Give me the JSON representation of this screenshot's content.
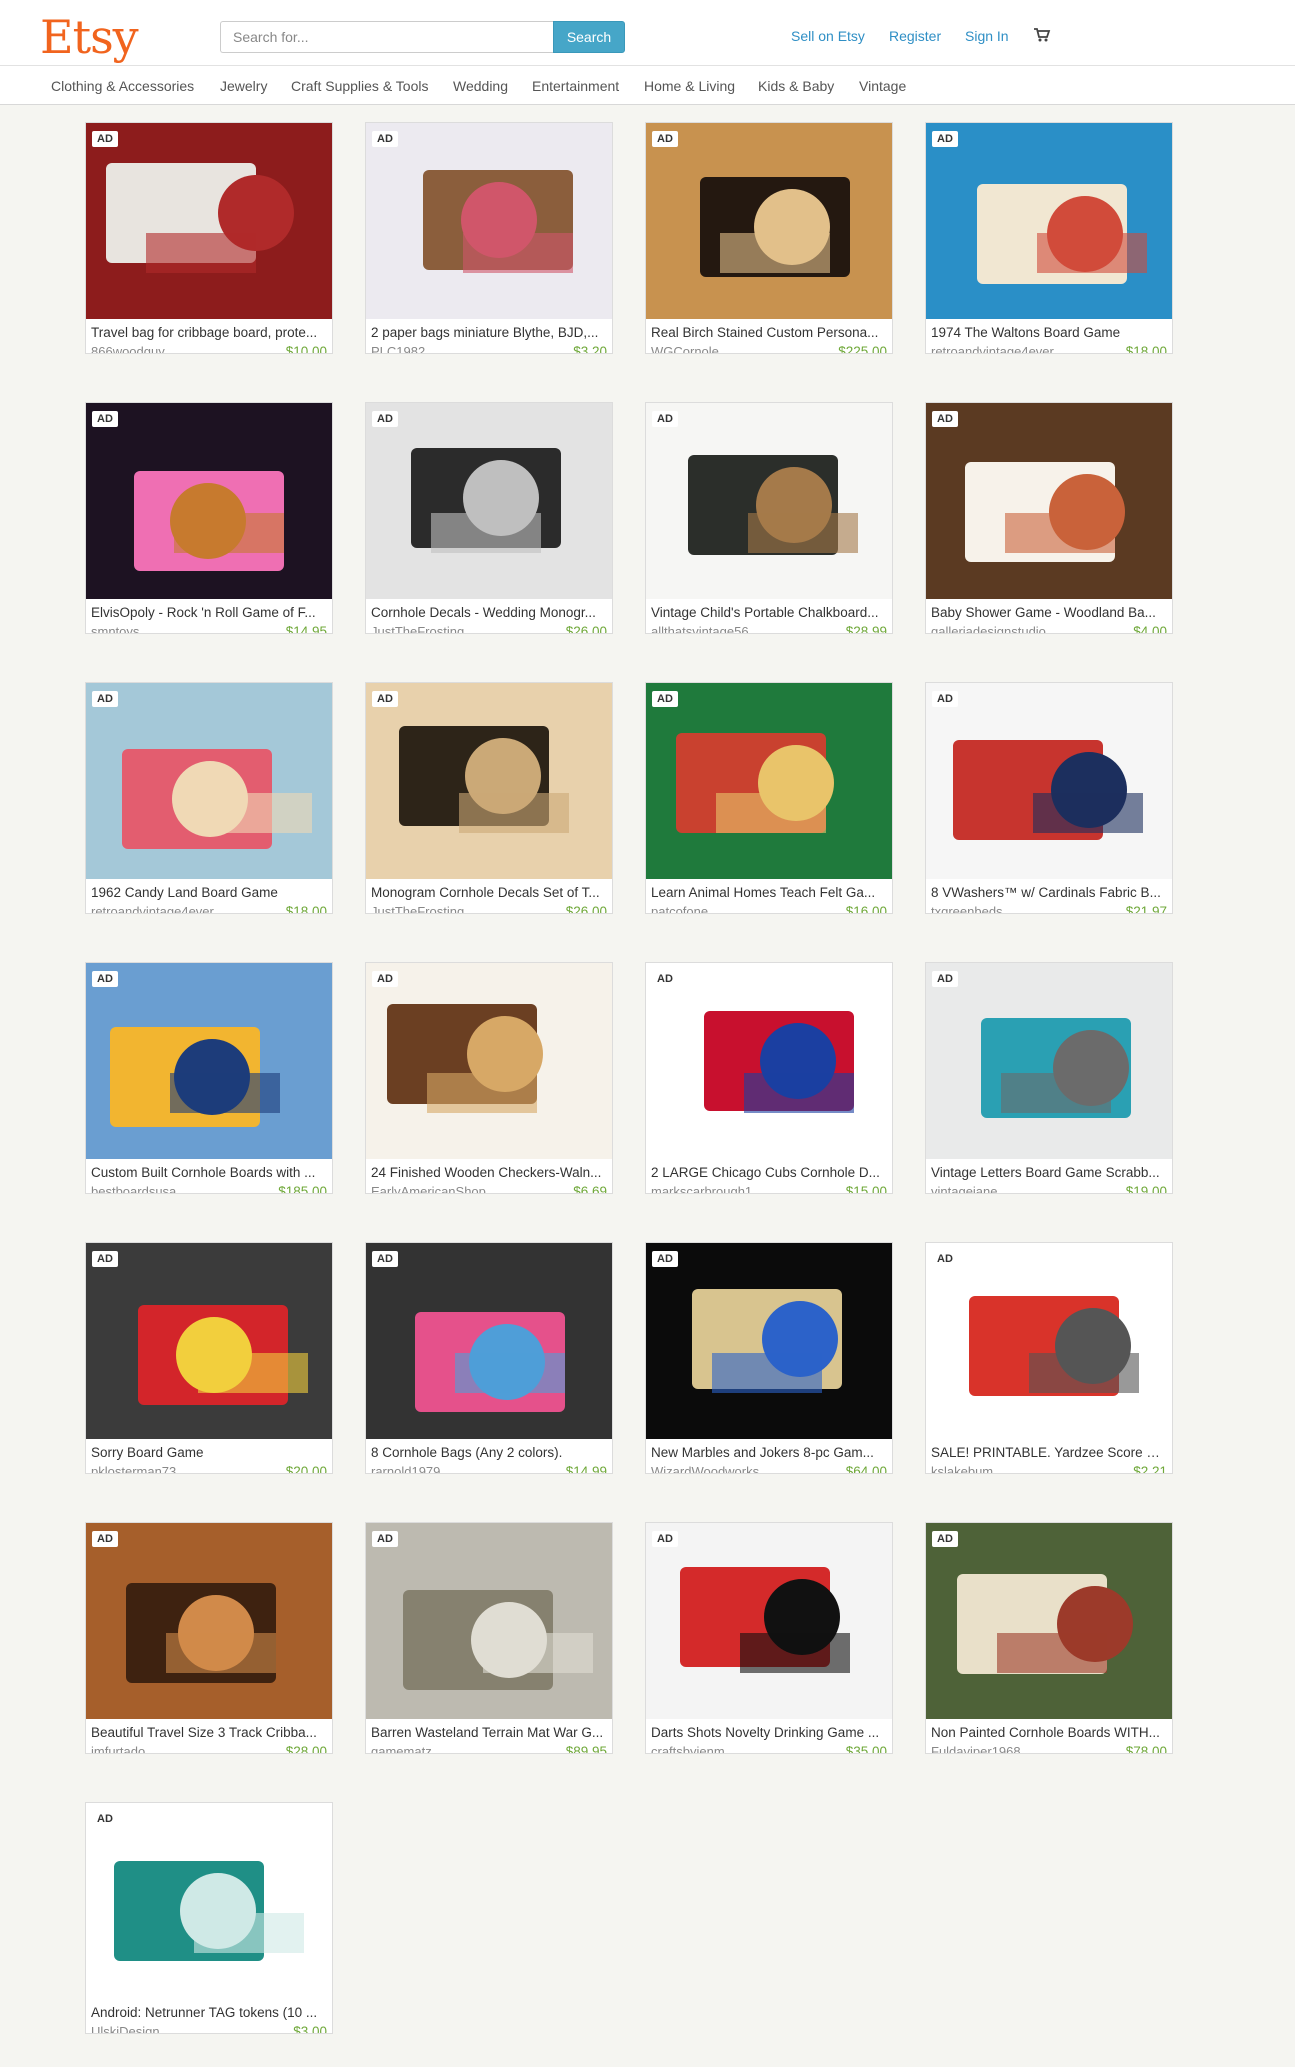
{
  "header": {
    "logo": "Etsy",
    "search_placeholder": "Search for...",
    "search_button": "Search",
    "links": [
      "Sell on Etsy",
      "Register",
      "Sign In"
    ]
  },
  "categories": [
    "Clothing & Accessories",
    "Jewelry",
    "Craft Supplies & Tools",
    "Wedding",
    "Entertainment",
    "Home & Living",
    "Kids & Baby",
    "Vintage"
  ],
  "ad_label": "AD",
  "items": [
    {
      "title": "Travel bag for cribbage board, prote...",
      "shop": "866woodguy",
      "price": "$10.00",
      "colors": [
        "#8d1c1c",
        "#e8e4df",
        "#b02a2a"
      ]
    },
    {
      "title": "2 paper bags miniature Blythe, BJD,...",
      "shop": "PLC1982",
      "price": "$3.20",
      "colors": [
        "#eceaf0",
        "#8b5e3c",
        "#d0566a"
      ]
    },
    {
      "title": "Real Birch Stained Custom Persona...",
      "shop": "WGCornole",
      "price": "$225.00",
      "colors": [
        "#c8924f",
        "#241810",
        "#e2c08a"
      ]
    },
    {
      "title": "1974 The Waltons Board Game",
      "shop": "retroandvintage4ever",
      "price": "$18.00",
      "colors": [
        "#2a8fc7",
        "#f1e7d2",
        "#d14b3a"
      ]
    },
    {
      "title": "ElvisOpoly - Rock 'n Roll Game of F...",
      "shop": "smntoys",
      "price": "$14.95",
      "colors": [
        "#1d1222",
        "#ef6fb3",
        "#c77a2e"
      ]
    },
    {
      "title": "Cornhole Decals - Wedding Monogr...",
      "shop": "JustTheFrosting",
      "price": "$26.00",
      "colors": [
        "#e3e3e3",
        "#2b2b2b",
        "#bfbfbf"
      ]
    },
    {
      "title": "Vintage Child's Portable Chalkboard...",
      "shop": "allthatsvintage56",
      "price": "$28.99",
      "colors": [
        "#f6f6f4",
        "#2b2e2a",
        "#a57a4a"
      ]
    },
    {
      "title": "Baby Shower Game - Woodland Ba...",
      "shop": "galleriadesignstudio",
      "price": "$4.00",
      "colors": [
        "#5b3a22",
        "#f7f2ea",
        "#c9623a"
      ]
    },
    {
      "title": "1962 Candy Land Board Game",
      "shop": "retroandvintage4ever",
      "price": "$18.00",
      "colors": [
        "#a4c8d8",
        "#e35d6f",
        "#f0d9b5"
      ]
    },
    {
      "title": "Monogram Cornhole Decals Set of T...",
      "shop": "JustTheFrosting",
      "price": "$26.00",
      "colors": [
        "#e8d1ac",
        "#2d2418",
        "#cba977"
      ]
    },
    {
      "title": "Learn Animal Homes Teach Felt Ga...",
      "shop": "patcofone",
      "price": "$16.00",
      "colors": [
        "#1f7a3c",
        "#c9412f",
        "#e9c46a"
      ]
    },
    {
      "title": "8 VWashers™ w/ Cardinals Fabric B...",
      "shop": "txgreenbeds",
      "price": "$21.97",
      "colors": [
        "#f6f6f6",
        "#c7342e",
        "#1c2f5e"
      ]
    },
    {
      "title": "Custom Built Cornhole Boards with ...",
      "shop": "bestboardsusa",
      "price": "$185.00",
      "colors": [
        "#6a9ed1",
        "#f2b530",
        "#1d3c7a"
      ]
    },
    {
      "title": "24 Finished Wooden Checkers-Waln...",
      "shop": "EarlyAmericanShop",
      "price": "$6.69",
      "colors": [
        "#f6f2ea",
        "#6b3f22",
        "#d7a866"
      ]
    },
    {
      "title": "2 LARGE Chicago Cubs Cornhole D...",
      "shop": "markscarbrough1",
      "price": "$15.00",
      "colors": [
        "#ffffff",
        "#c8102e",
        "#1b3fa1"
      ]
    },
    {
      "title": "Vintage Letters Board Game Scrabb...",
      "shop": "vintagejane",
      "price": "$19.00",
      "colors": [
        "#e9eaea",
        "#2aa0b3",
        "#6b6b6b"
      ]
    },
    {
      "title": "Sorry Board Game",
      "shop": "pklosterman73",
      "price": "$20.00",
      "colors": [
        "#3b3b3b",
        "#d3252a",
        "#f2cf3d"
      ]
    },
    {
      "title": "8 Cornhole Bags (Any 2 colors).",
      "shop": "rarnold1979",
      "price": "$14.99",
      "colors": [
        "#333333",
        "#e5518b",
        "#4f9ed8"
      ]
    },
    {
      "title": "New Marbles and Jokers 8-pc Gam...",
      "shop": "WizardWoodworks",
      "price": "$64.00",
      "colors": [
        "#0b0b0b",
        "#d8c48f",
        "#2c62c9"
      ]
    },
    {
      "title": "SALE! PRINTABLE. Yardzee Score C...",
      "shop": "kslakebum",
      "price": "$2.21",
      "colors": [
        "#ffffff",
        "#d9332a",
        "#555555"
      ]
    },
    {
      "title": "Beautiful Travel Size 3 Track Cribba...",
      "shop": "jmfurtado",
      "price": "$28.00",
      "colors": [
        "#a65f2b",
        "#3e2210",
        "#d18a4a"
      ]
    },
    {
      "title": "Barren Wasteland Terrain Mat War G...",
      "shop": "gamematz",
      "price": "$89.95",
      "colors": [
        "#bdbab0",
        "#86816f",
        "#e0ddd3"
      ]
    },
    {
      "title": "Darts Shots Novelty Drinking Game ...",
      "shop": "craftsbyjenm",
      "price": "$35.00",
      "colors": [
        "#f4f4f4",
        "#d42a2a",
        "#111111"
      ]
    },
    {
      "title": "Non Painted Cornhole Boards WITH...",
      "shop": "Fuldaviper1968",
      "price": "$78.00",
      "colors": [
        "#4e6238",
        "#e9e0c9",
        "#9c3a2a"
      ]
    },
    {
      "title": "Android: Netrunner TAG tokens (10 ...",
      "shop": "UlskiDesign",
      "price": "$3.00",
      "colors": [
        "#ffffff",
        "#1f8f86",
        "#cfe9e6"
      ]
    }
  ]
}
